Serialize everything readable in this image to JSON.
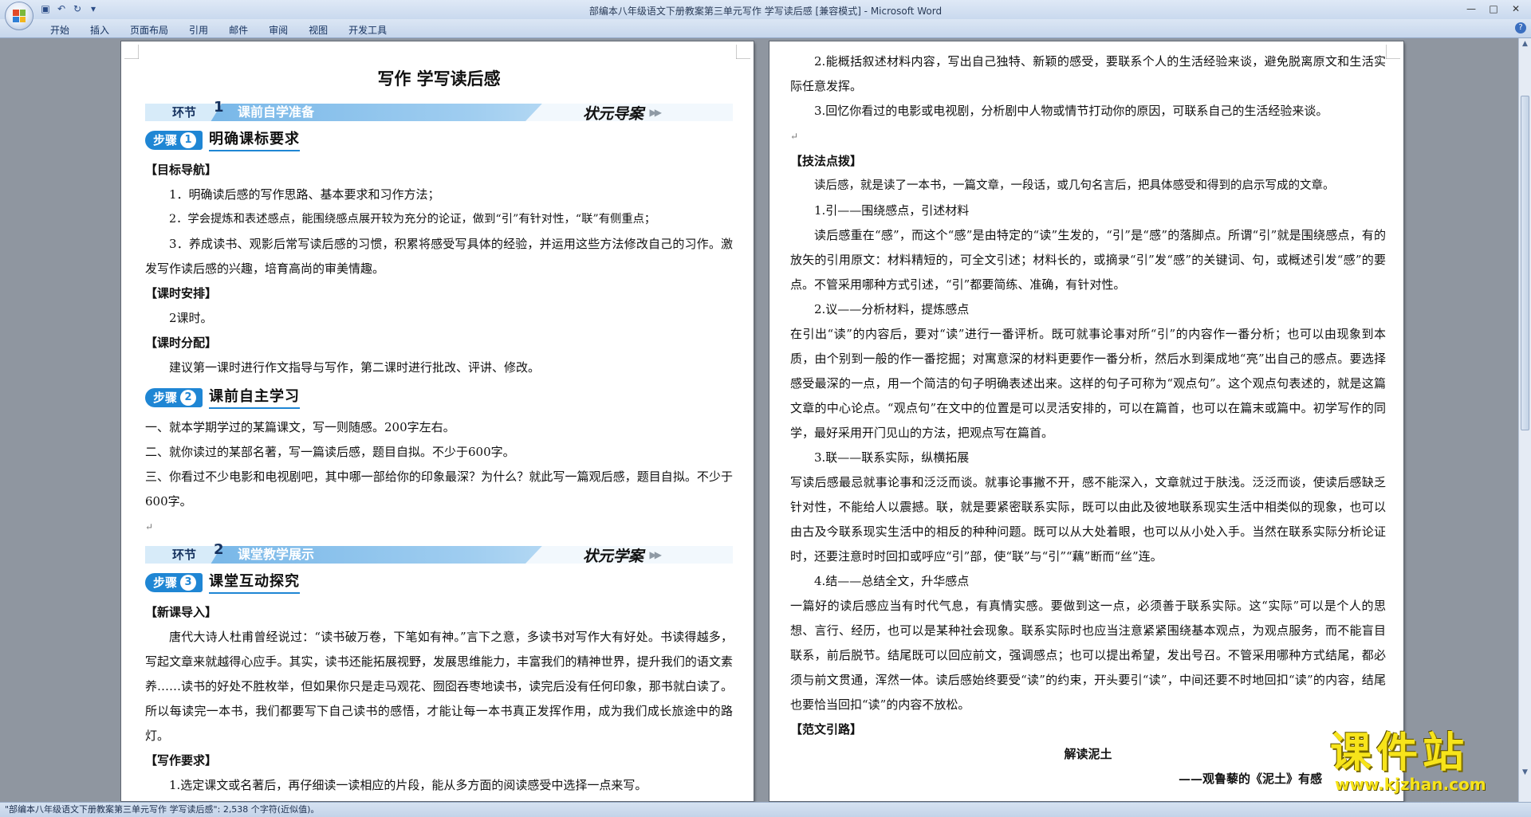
{
  "window": {
    "title": "部编本八年级语文下册教案第三单元写作 学写读后感 [兼容模式] - Microsoft Word",
    "controls": [
      "—",
      "□",
      "✕"
    ]
  },
  "ribbon": {
    "tabs": [
      "开始",
      "插入",
      "页面布局",
      "引用",
      "邮件",
      "审阅",
      "视图",
      "开发工具"
    ]
  },
  "left_page": {
    "heading": "写作  学写读后感",
    "banner1": {
      "cap": "环节",
      "num": "1",
      "label": "课前自学准备",
      "right": "状元导案"
    },
    "step1": {
      "pill": "步骤",
      "num": "1",
      "title": "明确课标要求"
    },
    "goal_title": "【目标导航】",
    "goals": [
      "1．明确读后感的写作思路、基本要求和习作方法；",
      "2．学会提炼和表述感点，能围绕感点展开较为充分的论证，做到“引”有针对性，“联”有侧重点；",
      "3．养成读书、观影后常写读后感的习惯，积累将感受写具体的经验，并运用这些方法修改自己的习作。激发写作读后感的兴趣，培育高尚的审美情趣。"
    ],
    "time_title": "【课时安排】",
    "time_text": "2课时。",
    "dist_title": "【课时分配】",
    "dist_text": "建议第一课时进行作文指导与写作，第二课时进行批改、评讲、修改。",
    "step2": {
      "pill": "步骤",
      "num": "2",
      "title": "课前自主学习"
    },
    "tasks": [
      "一、就本学期学过的某篇课文，写一则随感。200字左右。",
      "二、就你读过的某部名著，写一篇读后感，题目自拟。不少于600字。",
      "三、你看过不少电影和电视剧吧，其中哪一部给你的印象最深？为什么？就此写一篇观后感，题目自拟。不少于600字。"
    ],
    "banner2": {
      "cap": "环节",
      "num": "2",
      "label": "课堂教学展示",
      "right": "状元学案"
    },
    "step3": {
      "pill": "步骤",
      "num": "3",
      "title": "课堂互动探究"
    },
    "intro_title": "【新课导入】",
    "intro_text": "唐代大诗人杜甫曾经说过：“读书破万卷，下笔如有神。”言下之意，多读书对写作大有好处。书读得越多，写起文章来就越得心应手。其实，读书还能拓展视野，发展思维能力，丰富我们的精神世界，提升我们的语文素养……读书的好处不胜枚举，但如果你只是走马观花、囫囵吞枣地读书，读完后没有任何印象，那书就白读了。所以每读完一本书，我们都要写下自己读书的感悟，才能让每一本书真正发挥作用，成为我们成长旅途中的路灯。",
    "req_title": "【写作要求】",
    "req_text": "1.选定课文或名著后，再仔细读一读相应的片段，能从多方面的阅读感受中选择一点来写。"
  },
  "right_page": {
    "items": [
      "2.能概括叙述材料内容，写出自己独特、新颖的感受，要联系个人的生活经验来谈，避免脱离原文和生活实际任意发挥。",
      "3.回忆你看过的电影或电视剧，分析剧中人物或情节打动你的原因，可联系自己的生活经验来谈。"
    ],
    "tips_title": "【技法点拨】",
    "tips_intro": "读后感，就是读了一本书，一篇文章，一段话，或几句名言后，把具体感受和得到的启示写成的文章。",
    "s1_title": "1.引——围绕感点，引述材料",
    "s1_text": "读后感重在“感”，而这个“感”是由特定的“读”生发的，“引”是“感”的落脚点。所谓“引”就是围绕感点，有的放矢的引用原文：材料精短的，可全文引述；材料长的，或摘录“引”发“感”的关键词、句，或概述引发“感”的要点。不管采用哪种方式引述，“引”都要简练、准确，有针对性。",
    "s2_title": "2.议——分析材料，提炼感点",
    "s2_text": "在引出“读”的内容后，要对“读”进行一番评析。既可就事论事对所“引”的内容作一番分析；也可以由现象到本质，由个别到一般的作一番挖掘；对寓意深的材料更要作一番分析，然后水到渠成地“亮”出自己的感点。要选择感受最深的一点，用一个简洁的句子明确表述出来。这样的句子可称为“观点句”。这个观点句表述的，就是这篇文章的中心论点。“观点句”在文中的位置是可以灵活安排的，可以在篇首，也可以在篇末或篇中。初学写作的同学，最好采用开门见山的方法，把观点写在篇首。",
    "s3_title": "3.联——联系实际，纵横拓展",
    "s3_text": "写读后感最忌就事论事和泛泛而谈。就事论事撇不开，感不能深入，文章就过于肤浅。泛泛而谈，使读后感缺乏针对性，不能给人以震撼。联，就是要紧密联系实际，既可以由此及彼地联系现实生活中相类似的现象，也可以由古及今联系现实生活中的相反的种种问题。既可以从大处着眼，也可以从小处入手。当然在联系实际分析论证时，还要注意时时回扣或呼应“引”部，使“联”与“引”“藕”断而“丝”连。",
    "s4_title": "4.结——总结全文，升华感点",
    "s4_text": "一篇好的读后感应当有时代气息，有真情实感。要做到这一点，必须善于联系实际。这“实际”可以是个人的思想、言行、经历，也可以是某种社会现象。联系实际时也应当注意紧紧围绕基本观点，为观点服务，而不能盲目联系，前后脱节。结尾既可以回应前文，强调感点；也可以提出希望，发出号召。不管采用哪种方式结尾，都必须与前文贯通，浑然一体。读后感始终要受“读”的约束，开头要引“读”，中间还要不时地回扣“读”的内容，结尾也要恰当回扣“读”的内容不放松。",
    "sample_title": "【范文引路】",
    "sample_heading": "解读泥土",
    "sample_sub": "——观鲁藜的《泥土》有感"
  },
  "statusbar": {
    "text": "\"部编本八年级语文下册教案第三单元写作 学写读后感\": 2,538 个字符(近似值)。"
  },
  "watermark": {
    "big": "课件站",
    "url": "www.kjzhan.com"
  },
  "colors": {
    "accent": "#1f86d4",
    "banner": "#6fb2e6",
    "watermark": "#f7e41a"
  }
}
